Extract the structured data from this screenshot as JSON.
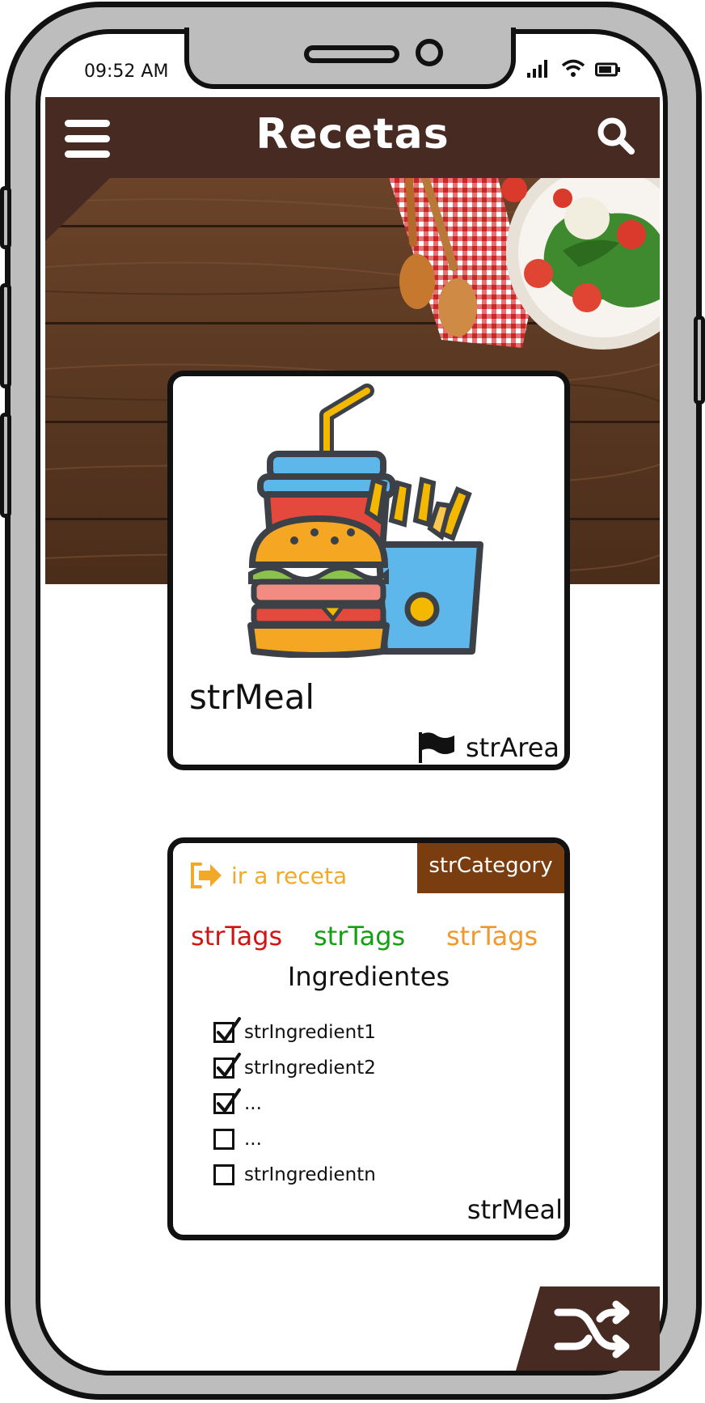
{
  "status_bar": {
    "time": "09:52 AM"
  },
  "header": {
    "title": "Recetas",
    "menu_icon": "hamburger-icon",
    "search_icon": "search-icon"
  },
  "meal_card": {
    "meal": "strMeal",
    "area": "strArea",
    "area_icon": "flag-icon"
  },
  "detail_card": {
    "category": "strCategory",
    "go_recipe": "ir a receta",
    "tags": [
      {
        "label": "strTags",
        "color": "#d11515"
      },
      {
        "label": "strTags",
        "color": "#14a014"
      },
      {
        "label": "strTags",
        "color": "#f0992e"
      }
    ],
    "ingredients_title": "Ingredientes",
    "ingredients": [
      {
        "label": "strIngredient1",
        "checked": true
      },
      {
        "label": "strIngredient2",
        "checked": true
      },
      {
        "label": "...",
        "checked": true
      },
      {
        "label": "...",
        "checked": false
      },
      {
        "label": "strIngredientn",
        "checked": false
      }
    ],
    "meal": "strMeal"
  },
  "colors": {
    "header_bg": "#472b23",
    "category_bg": "#7a3d10",
    "link": "#f2a928"
  }
}
